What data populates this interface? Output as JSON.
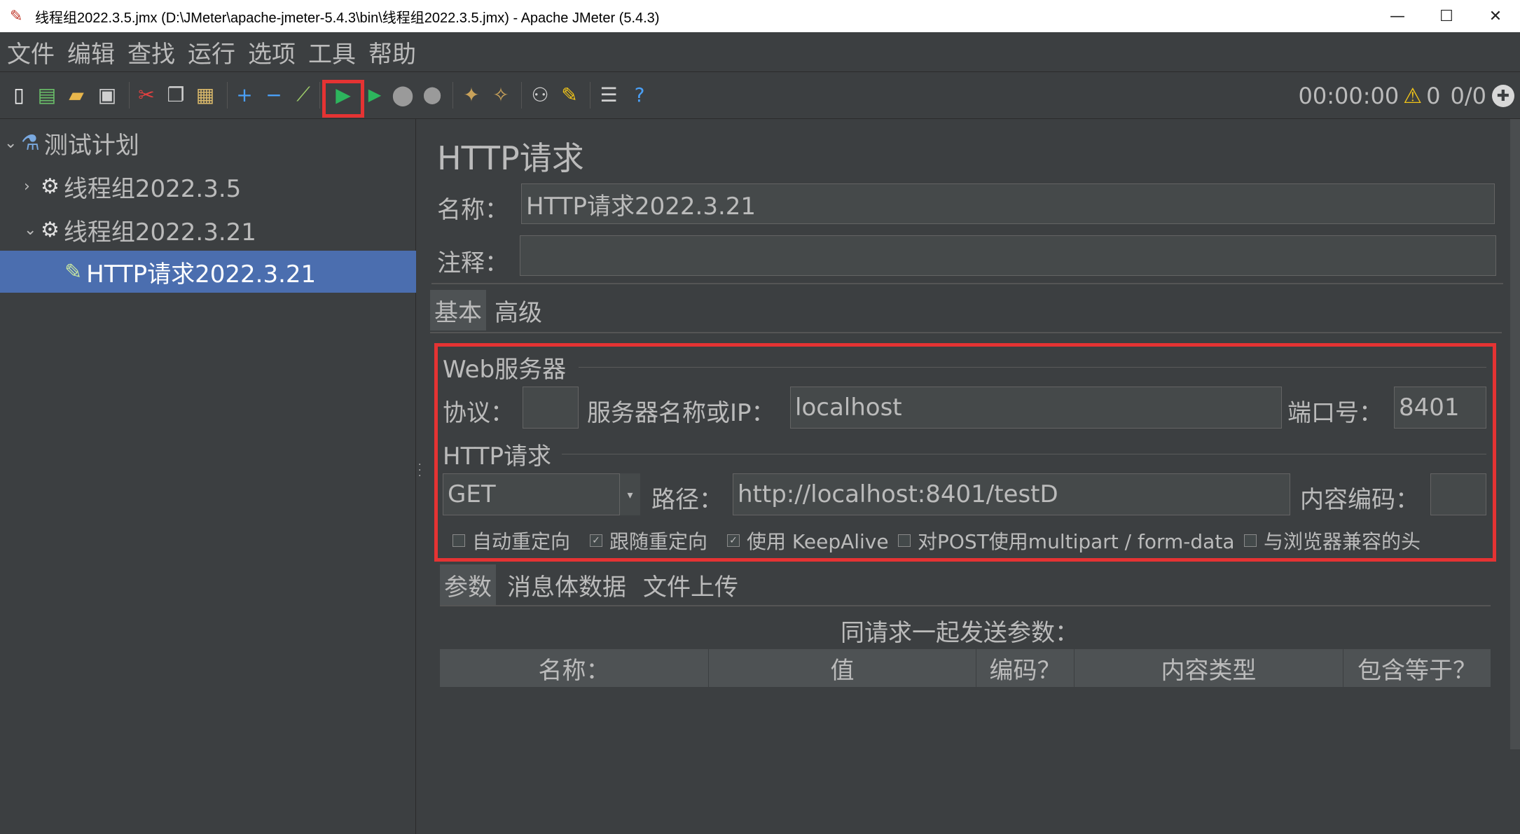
{
  "window": {
    "title": "线程组2022.3.5.jmx (D:\\JMeter\\apache-jmeter-5.4.3\\bin\\线程组2022.3.5.jmx) - Apache JMeter (5.4.3)",
    "minimize": "—",
    "maximize": "☐",
    "close": "✕"
  },
  "menu": [
    "文件",
    "编辑",
    "查找",
    "运行",
    "选项",
    "工具",
    "帮助"
  ],
  "toolbar": {
    "timer": "00:00:00",
    "warning_count": "0",
    "threads": "0/0"
  },
  "tree": {
    "items": [
      {
        "label": "测试计划"
      },
      {
        "label": "线程组2022.3.5"
      },
      {
        "label": "线程组2022.3.21"
      },
      {
        "label": "HTTP请求2022.3.21"
      }
    ]
  },
  "panel": {
    "title": "HTTP请求",
    "name_label": "名称：",
    "name_value": "HTTP请求2022.3.21",
    "comment_label": "注释：",
    "comment_value": "",
    "tabs": [
      "基本",
      "高级"
    ],
    "web_server": {
      "title": "Web服务器",
      "protocol_label": "协议：",
      "protocol_value": "",
      "server_label": "服务器名称或IP：",
      "server_value": "localhost",
      "port_label": "端口号：",
      "port_value": "8401"
    },
    "http_request": {
      "title": "HTTP请求",
      "method": "GET",
      "path_label": "路径：",
      "path_value": "http://localhost:8401/testD",
      "encoding_label": "内容编码：",
      "encoding_value": ""
    },
    "checkboxes": [
      {
        "label": "自动重定向",
        "checked": false
      },
      {
        "label": "跟随重定向",
        "checked": true
      },
      {
        "label": "使用 KeepAlive",
        "checked": true
      },
      {
        "label": "对POST使用multipart / form-data",
        "checked": false
      },
      {
        "label": "与浏览器兼容的头",
        "checked": false
      }
    ],
    "sub_tabs": [
      "参数",
      "消息体数据",
      "文件上传"
    ],
    "params_caption": "同请求一起发送参数：",
    "columns": [
      "名称：",
      "值",
      "编码？",
      "内容类型",
      "包含等于？"
    ]
  }
}
